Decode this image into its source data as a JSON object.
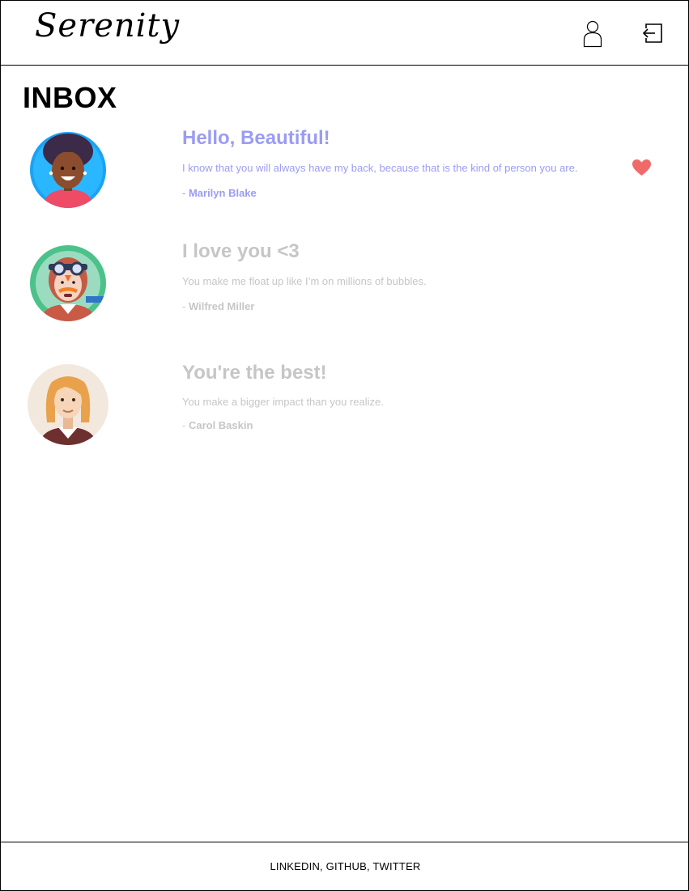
{
  "header": {
    "logo": "Serenity",
    "profile_icon": "profile-icon",
    "logout_icon": "logout-icon"
  },
  "page": {
    "title": "INBOX"
  },
  "colors": {
    "active": "#9b9cf3",
    "inactive": "#c6c6c6",
    "heart": "#f06a6a"
  },
  "messages": [
    {
      "title": "Hello, Beautiful!",
      "body": "I know that you will always have my back, because that is the kind of person you are.",
      "dash": "- ",
      "author": "Marilyn Blake",
      "state": "active",
      "liked": true
    },
    {
      "title": "I love you <3",
      "body": "You make me float up like I’m on millions of bubbles.",
      "dash": "- ",
      "author": "Wilfred Miller",
      "state": "read",
      "liked": false
    },
    {
      "title": "You're the best!",
      "body": "You make a bigger impact than you realize.",
      "dash": "- ",
      "author": "Carol Baskin",
      "state": "read",
      "liked": false
    }
  ],
  "footer": {
    "links": [
      "LINKEDIN",
      "GITHUB",
      "TWITTER"
    ],
    "separator": ", "
  }
}
